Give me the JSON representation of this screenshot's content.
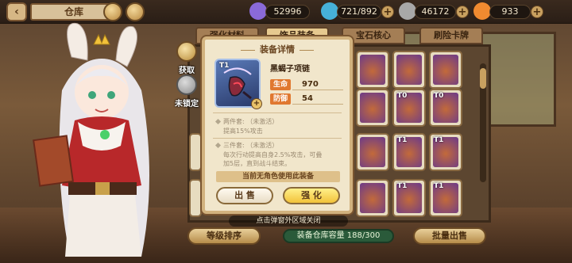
{
  "topbar": {
    "back_glyph": "‹",
    "title": "仓库",
    "resources": [
      {
        "icon": "crystal-icon",
        "value": "52996",
        "color": "#8a6ad8"
      },
      {
        "icon": "stamina-icon",
        "value": "721/892",
        "color": "#46b0d8"
      },
      {
        "icon": "coin-icon",
        "value": "46172",
        "color": "#a8a8a8"
      },
      {
        "icon": "carrot-icon",
        "value": "933",
        "color": "#f08a30"
      }
    ],
    "plus": "+"
  },
  "tabs": [
    {
      "label": "强化材料",
      "active": false
    },
    {
      "label": "饰品装备",
      "active": true
    },
    {
      "label": "宝石核心",
      "active": false
    },
    {
      "label": "刷险卡牌",
      "active": false
    }
  ],
  "side": {
    "obtain": "获取",
    "unlock": "未锁定"
  },
  "grid": {
    "tier": "T1",
    "tier0": "T0"
  },
  "popup": {
    "title": "装备详情",
    "item_tier": "T1",
    "item_name": "黑蝎子项链",
    "stats": [
      {
        "label": "生命",
        "value": "970"
      },
      {
        "label": "防御",
        "value": "54"
      }
    ],
    "set2_line1": "两件套:  （未激活）",
    "set2_line2": "提高15%攻击",
    "set3_line1": "三件套:  （未激活）",
    "set3_line2": "每次行动提高自身2.5%攻击，可叠",
    "set3_line3": "加5层，直到战斗结束。",
    "banner": "当前无角色使用此装备",
    "sell_label": "出 售",
    "enhance_label": "强 化"
  },
  "bottom": {
    "hint": "点击弹窗外区域关闭",
    "sort_label": "等级排序",
    "capacity": "装备仓库容量 188/300",
    "batch_sell_label": "批量出售"
  }
}
